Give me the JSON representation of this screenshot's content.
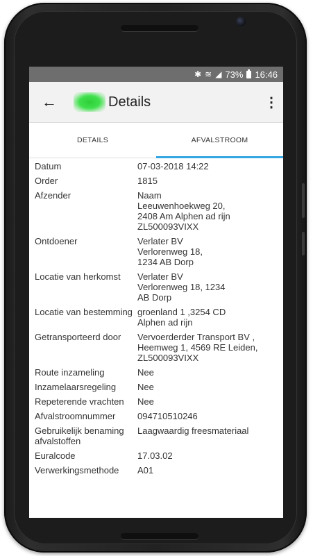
{
  "status_bar": {
    "icons": [
      "bluetooth-icon",
      "wifi-icon",
      "signal-icon",
      "battery-icon"
    ],
    "battery": "73%",
    "time": "16:46"
  },
  "toolbar": {
    "title": "Details",
    "back_icon": "arrow-left-icon",
    "menu_icon": "more-vert-icon"
  },
  "tabs": [
    {
      "label": "DETAILS",
      "active": false
    },
    {
      "label": "AFVALSTROOM",
      "active": true
    }
  ],
  "details": [
    {
      "label": "Datum",
      "lines": [
        "07-03-2018 14:22"
      ]
    },
    {
      "label": "Order",
      "lines": [
        "1815"
      ]
    },
    {
      "label": "Afzender",
      "lines": [
        "Naam",
        "Leeuwenhoekweg 20,",
        "2408 Am Alphen ad rijn",
        "ZL500093VIXX"
      ]
    },
    {
      "label": "Ontdoener",
      "lines": [
        "Verlater BV",
        "Verlorenweg 18,",
        "1234 AB Dorp"
      ]
    },
    {
      "label": "Locatie van herkomst",
      "lines": [
        "Verlater BV",
        "Verlorenweg 18, 1234",
        "AB Dorp"
      ]
    },
    {
      "label": "Locatie van bestemming",
      "lines": [
        "groenland 1 ,3254 CD",
        "Alphen ad rijn"
      ]
    },
    {
      "label": "Getransporteerd door",
      "lines": [
        "Vervoerderder Transport BV ,",
        "Heemweg 1, 4569 RE Leiden,",
        "ZL500093VIXX"
      ]
    },
    {
      "label": "Route inzameling",
      "lines": [
        "Nee"
      ]
    },
    {
      "label": "Inzamelaarsregeling",
      "lines": [
        "Nee"
      ]
    },
    {
      "label": "Repeterende vrachten",
      "lines": [
        "Nee"
      ]
    },
    {
      "label": "Afvalstroomnummer",
      "lines": [
        "094710510246"
      ]
    },
    {
      "label": "Gebruikelijk benaming afvalstoffen",
      "lines": [
        "Laagwaardig freesmateriaal"
      ]
    },
    {
      "label": "Euralcode",
      "lines": [
        "17.03.02"
      ]
    },
    {
      "label": "Verwerkingsmethode",
      "lines": [
        "A01"
      ]
    }
  ],
  "colors": {
    "status_bar": "#6e6e6e",
    "toolbar": "#f2f2f2",
    "tab_indicator": "#33a5e0",
    "logo": "#3fe04c"
  }
}
